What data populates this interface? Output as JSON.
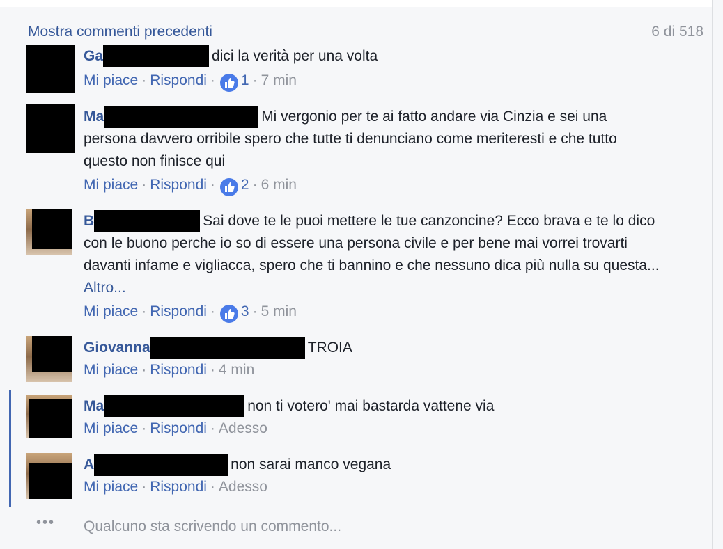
{
  "header": {
    "more_comments": "Mostra commenti precedenti",
    "count": "6 di 518"
  },
  "actions": {
    "like": "Mi piace",
    "reply": "Rispondi",
    "separator": "·"
  },
  "comments": [
    {
      "author": "Ga",
      "text": "dici la verità per una volta",
      "likes": "1",
      "time": "7 min"
    },
    {
      "author": "Ma",
      "text_line1": "Mi vergonio per te ai fatto andare via",
      "text_rest": "Cinzia e sei una persona davvero orribile spero che tutte ti denunciano come meriteresti e che tutto questo non finisce qui",
      "likes": "2",
      "time": "6 min"
    },
    {
      "author": "B",
      "text_line1": "Sai dove te le puoi mettere le tue canzoncine? Ecco brava e",
      "text_rest": "te lo dico con le buono perche io so di essere una persona civile e per bene mai vorrei trovarti davanti infame e vigliacca, spero che ti bannino e che nessuno dica più nulla su questa...",
      "more": "Altro...",
      "likes": "3",
      "time": "5 min"
    },
    {
      "author": "Giovanna",
      "text": "TROIA",
      "time": "4 min"
    },
    {
      "author": "Ma",
      "text": "non ti votero' mai bastarda vattene via",
      "time": "Adesso"
    },
    {
      "author": "A",
      "text": "non sarai manco vegana",
      "time": "Adesso"
    }
  ],
  "typing": {
    "dots": "•••",
    "text": "Qualcuno sta scrivendo un commento..."
  },
  "icons": [
    "like-thumb-icon",
    "typing-dots-icon"
  ],
  "colors": {
    "link": "#365899",
    "action": "#4267b2",
    "muted": "#90949c",
    "like_badge": "#4a7be8",
    "background": "#f6f7f9"
  }
}
